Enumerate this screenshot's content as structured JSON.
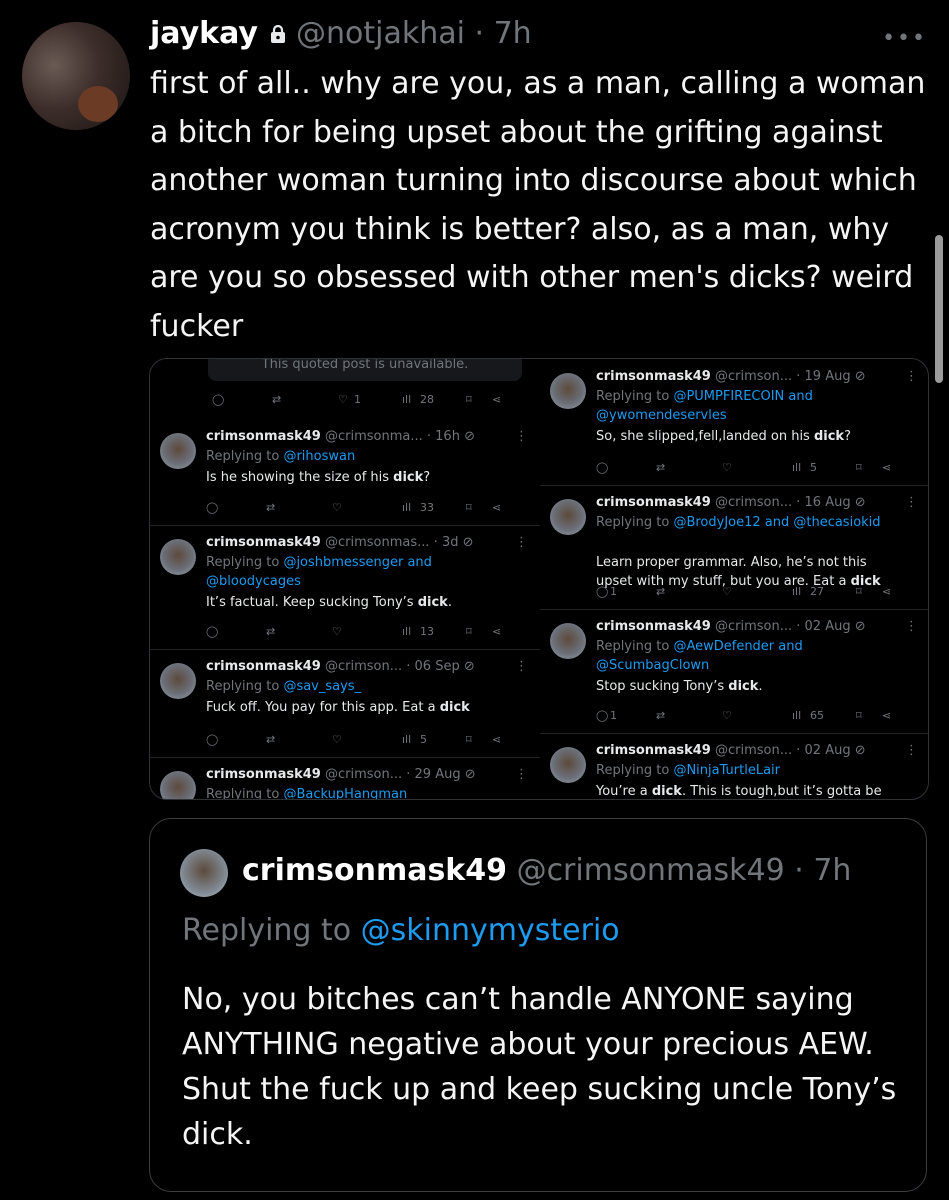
{
  "tweet": {
    "name": "jaykay",
    "handle": "@notjakhai",
    "time": "7h",
    "dot": " · ",
    "more": "•••",
    "text": "first of all.. why are you, as a man, calling a woman a bitch for being upset about the grifting against another woman turning into discourse about which acronym you think is better? also, as a man, why are you so obsessed with other men's dicks? weird fucker",
    "icons": {
      "avatar": "avatar-photo",
      "lock": "lock-icon",
      "more": "more-options-icon"
    }
  },
  "media": {
    "unavailable": "This quoted post is unavailable.",
    "top_actions": {
      "likes": "1",
      "views": "28"
    },
    "left": [
      {
        "name": "crimsonmask49",
        "handle": "@crimsonma...",
        "time": "16h",
        "replying": "Replying to @rihoswan",
        "reply_prefix": "Replying to ",
        "reply_to": "@rihoswan",
        "text_before": "Is he showing the size of his ",
        "bold": "dick",
        "text_after": "?",
        "replies": "",
        "likes": "",
        "views": "33"
      },
      {
        "name": "crimsonmask49",
        "handle": "@crimsonmas...",
        "time": "3d",
        "reply_prefix": "Replying to ",
        "reply_to": "@joshbmessenger and @bloodycages",
        "text_before": "It’s factual. Keep sucking Tony’s ",
        "bold": "dick",
        "text_after": ".",
        "replies": "",
        "likes": "",
        "views": "13"
      },
      {
        "name": "crimsonmask49",
        "handle": "@crimson...",
        "time": "06 Sep",
        "reply_prefix": "Replying to ",
        "reply_to": "@sav_says_",
        "text_before": "Fuck off. You pay for this app. Eat a ",
        "bold": "dick",
        "text_after": "",
        "replies": "",
        "likes": "",
        "views": "5"
      },
      {
        "name": "crimsonmask49",
        "handle": "@crimson...",
        "time": "29 Aug",
        "reply_prefix": "Replying to ",
        "reply_to": "@BackupHangman",
        "text_before": "",
        "bold": "",
        "text_after": "",
        "replies": "",
        "likes": "",
        "views": ""
      }
    ],
    "right": [
      {
        "name": "crimsonmask49",
        "handle": "@crimson...",
        "time": "19 Aug",
        "reply_prefix": "Replying to ",
        "reply_to": "@PUMPFIRECOIN and @ywomendeservles",
        "text_before": "So, she slipped,fell,landed on his ",
        "bold": "dick",
        "text_after": "?",
        "replies": "",
        "likes": "",
        "views": "5"
      },
      {
        "name": "crimsonmask49",
        "handle": "@crimson...",
        "time": "16 Aug",
        "reply_prefix": "Replying to ",
        "reply_to": "@BrodyJoe12 and @thecasiokid",
        "text_before": "Learn proper grammar. Also, he’s not this upset with my stuff, but you are. Eat a ",
        "bold": "dick",
        "text_after": "",
        "replies": "1",
        "likes": "",
        "views": "27"
      },
      {
        "name": "crimsonmask49",
        "handle": "@crimson...",
        "time": "02 Aug",
        "reply_prefix": "Replying to ",
        "reply_to": "@AewDefender and @ScumbagClown",
        "text_before": "Stop sucking Tony’s ",
        "bold": "dick",
        "text_after": ".",
        "replies": "1",
        "likes": "",
        "views": "65"
      },
      {
        "name": "crimsonmask49",
        "handle": "@crimson...",
        "time": "02 Aug",
        "reply_prefix": "Replying to ",
        "reply_to": "@NinjaTurtleLair",
        "text_before": "You’re a ",
        "bold": "dick",
        "text_after": ". This is tough,but it’s gotta be",
        "replies": "",
        "likes": "",
        "views": ""
      }
    ]
  },
  "quote": {
    "name": "crimsonmask49",
    "handle": "@crimsonmask49",
    "time": "7h",
    "reply_prefix": "Replying to ",
    "reply_to": "@skinnymysterio",
    "text": "No, you bitches can’t handle ANYONE saying ANYTHING negative about your precious AEW. Shut the fuck up and keep sucking uncle Tony’s dick."
  },
  "colors": {
    "background": "#000000",
    "text": "#e7e9ea",
    "muted": "#71767b",
    "link": "#1d9bf0"
  }
}
